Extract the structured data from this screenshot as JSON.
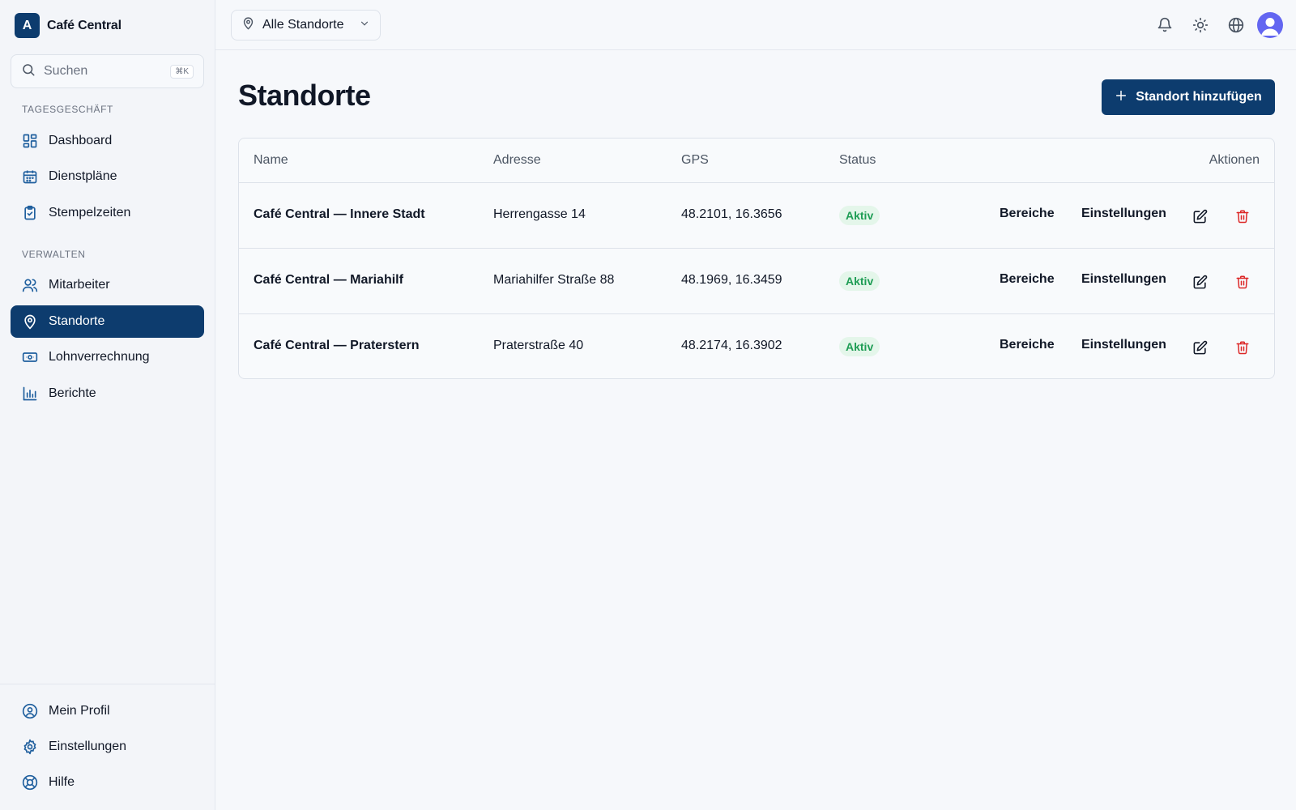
{
  "brand": {
    "logo_letter": "A",
    "name": "Café Central"
  },
  "search": {
    "label": "Suchen",
    "shortcut": "⌘K"
  },
  "sidebar": {
    "section_daily": "TAGESGESCHÄFT",
    "section_manage": "VERWALTEN",
    "items": [
      {
        "label": "Dashboard",
        "icon": "dashboard-grid-icon"
      },
      {
        "label": "Dienstpläne",
        "icon": "calendar-icon"
      },
      {
        "label": "Stempelzeiten",
        "icon": "clipboard-check-icon"
      },
      {
        "label": "Mitarbeiter",
        "icon": "users-icon"
      },
      {
        "label": "Standorte",
        "icon": "map-pin-icon",
        "active": true
      },
      {
        "label": "Lohnverrechnung",
        "icon": "banknote-icon"
      },
      {
        "label": "Berichte",
        "icon": "bar-chart-icon"
      }
    ],
    "bottom_items": [
      {
        "label": "Mein Profil",
        "icon": "user-circle-icon"
      },
      {
        "label": "Einstellungen",
        "icon": "gear-icon"
      },
      {
        "label": "Hilfe",
        "icon": "lifebuoy-icon"
      }
    ]
  },
  "topbar": {
    "location_select": "Alle Standorte",
    "icons": [
      "bell-icon",
      "sun-icon",
      "globe-icon",
      "avatar"
    ]
  },
  "page": {
    "title": "Standorte",
    "add_button": "Standort hinzufügen"
  },
  "table": {
    "columns": [
      "Name",
      "Adresse",
      "GPS",
      "Status",
      "Aktionen"
    ],
    "rows": [
      {
        "name": "Café Central — Innere Stadt",
        "address": "Herrengasse 14",
        "gps": "48.2101, 16.3656",
        "status": "Aktiv",
        "action_areas": "Bereiche",
        "action_settings": "Einstellungen"
      },
      {
        "name": "Café Central — Mariahilf",
        "address": "Mariahilfer Straße 88",
        "gps": "48.1969, 16.3459",
        "status": "Aktiv",
        "action_areas": "Bereiche",
        "action_settings": "Einstellungen"
      },
      {
        "name": "Café Central — Praterstern",
        "address": "Praterstraße 40",
        "gps": "48.2174, 16.3902",
        "status": "Aktiv",
        "action_areas": "Bereiche",
        "action_settings": "Einstellungen"
      }
    ]
  },
  "colors": {
    "primary": "#0d3c6e",
    "icon_accent": "#1f5f9e",
    "status_bg": "#e4f6ea",
    "status_text": "#1f9d55",
    "danger": "#dc2626",
    "avatar": "#6366f1"
  }
}
